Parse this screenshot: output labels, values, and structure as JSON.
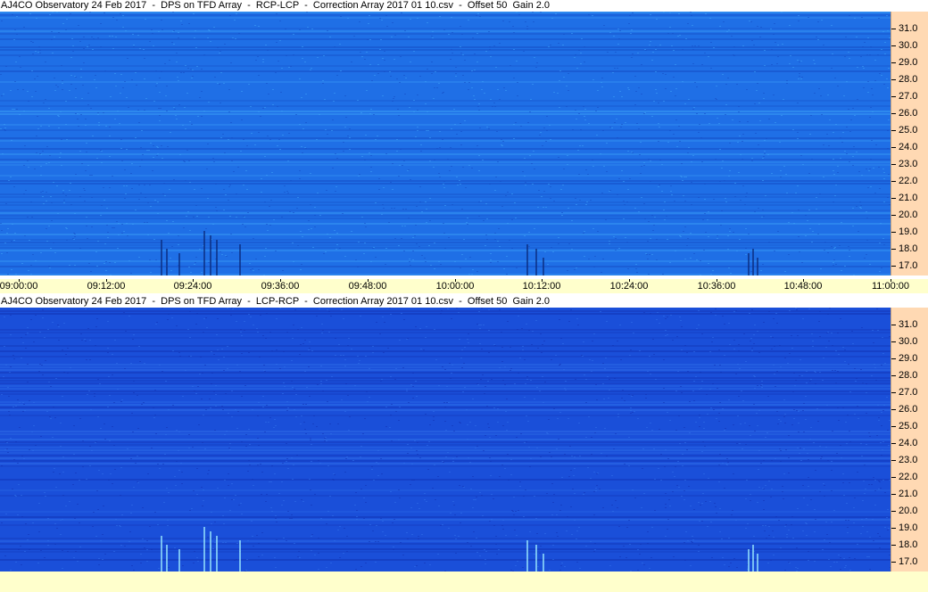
{
  "panels": [
    {
      "title": "AJ4CO Observatory 24 Feb 2017  -  DPS on TFD Array  -  RCP-LCP  -  Correction Array 2017 01 10.csv  -  Offset 50  Gain 2.0",
      "colors": {
        "base": "#1f6fe6",
        "light": "#3a9cf5",
        "dark": "#1550c8",
        "burst": "#0a2a7a"
      }
    },
    {
      "title": "AJ4CO Observatory 24 Feb 2017  -  DPS on TFD Array  -  LCP-RCP  -  Correction Array 2017 01 10.csv  -  Offset 50  Gain 2.0",
      "colors": {
        "base": "#1a4fd9",
        "light": "#2f6ee8",
        "dark": "#1336b8",
        "burst": "#a0f0ff"
      }
    }
  ],
  "frequency_labels": [
    "31.0",
    "30.0",
    "29.0",
    "28.0",
    "27.0",
    "26.0",
    "25.0",
    "24.0",
    "23.0",
    "22.0",
    "21.0",
    "20.0",
    "19.0",
    "18.0",
    "17.0"
  ],
  "time_labels": [
    "09:00:00",
    "09:12:00",
    "09:24:00",
    "09:36:00",
    "09:48:00",
    "10:00:00",
    "10:12:00",
    "10:24:00",
    "10:36:00",
    "10:48:00",
    "11:00:00"
  ],
  "colors": {
    "axis_bg": "#ffd9b3",
    "timebar_bg": "#ffffcc"
  }
}
